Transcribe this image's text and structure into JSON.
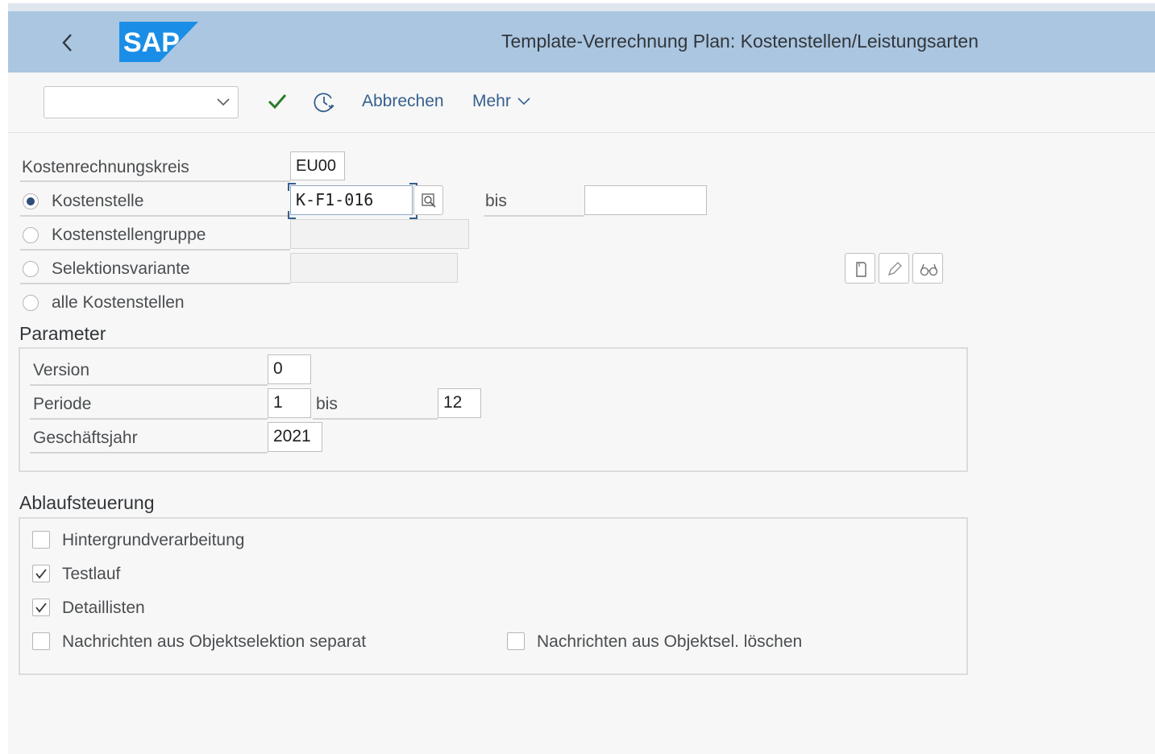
{
  "header": {
    "title": "Template-Verrechnung Plan: Kostenstellen/Leistungsarten",
    "logo_text": "SAP",
    "colors": {
      "bar": "#aac6e1",
      "logo": "#1a8ee6"
    }
  },
  "toolbar": {
    "select_value": "",
    "cancel_label": "Abbrechen",
    "more_label": "Mehr"
  },
  "selection": {
    "kostenrechnungskreis": {
      "label": "Kostenrechnungskreis",
      "value": "EU00"
    },
    "kostenstelle": {
      "label": "Kostenstelle",
      "value": "K-F1-016",
      "bis_label": "bis",
      "bis_value": "",
      "selected": true
    },
    "kostenstellengruppe": {
      "label": "Kostenstellengruppe",
      "value": ""
    },
    "selektionsvariante": {
      "label": "Selektionsvariante",
      "value": ""
    },
    "alle": {
      "label": "alle Kostenstellen"
    }
  },
  "parameter": {
    "title": "Parameter",
    "version": {
      "label": "Version",
      "value": "0"
    },
    "periode": {
      "label": "Periode",
      "from": "1",
      "bis_label": "bis",
      "to": "12"
    },
    "geschaeftsjahr": {
      "label": "Geschäftsjahr",
      "value": "2021"
    }
  },
  "ablauf": {
    "title": "Ablaufsteuerung",
    "hintergrund": {
      "label": "Hintergrundverarbeitung",
      "checked": false
    },
    "testlauf": {
      "label": "Testlauf",
      "checked": true
    },
    "detaillisten": {
      "label": "Detaillisten",
      "checked": true
    },
    "nachrichten_separat": {
      "label": "Nachrichten aus Objektselektion separat",
      "checked": false
    },
    "nachrichten_loeschen": {
      "label": "Nachrichten aus Objektsel. löschen",
      "checked": false
    }
  }
}
